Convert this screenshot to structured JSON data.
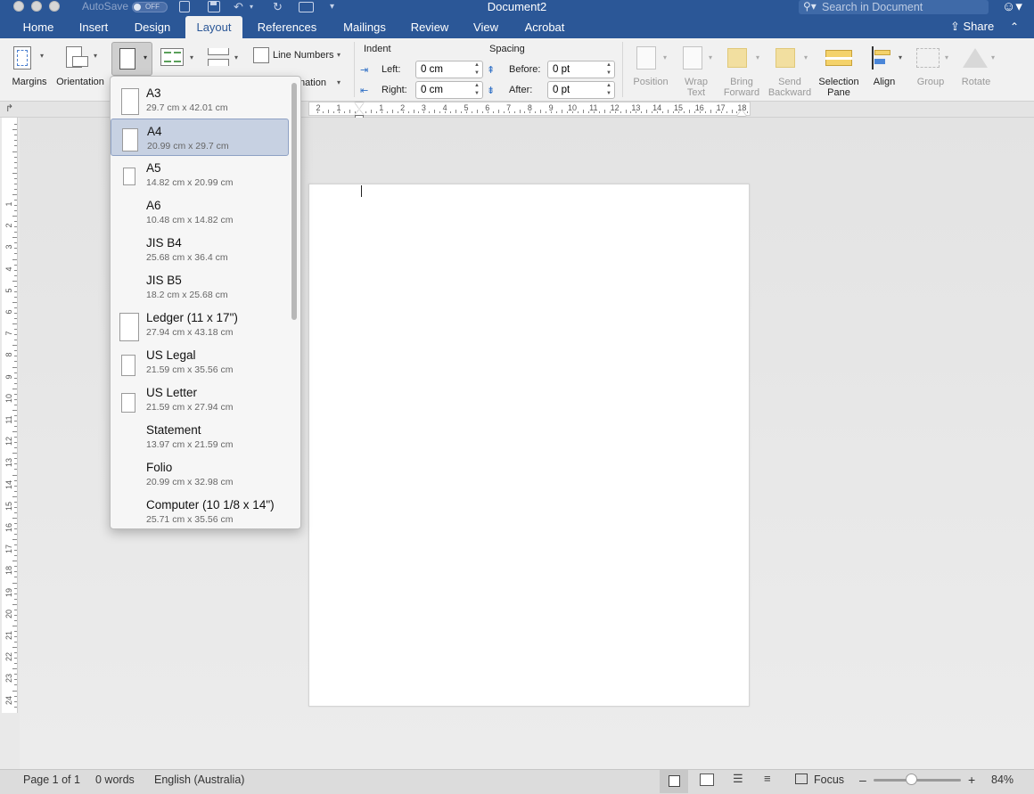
{
  "titlebar": {
    "autosave_label": "AutoSave",
    "autosave_state": "OFF",
    "document_title": "Document2",
    "search_placeholder": "Search in Document"
  },
  "tabs": [
    "Home",
    "Insert",
    "Design",
    "Layout",
    "References",
    "Mailings",
    "Review",
    "View",
    "Acrobat"
  ],
  "active_tab": "Layout",
  "share_label": "Share",
  "ribbon": {
    "margins_label": "Margins",
    "orientation_label": "Orientation",
    "line_numbers_label": "Line Numbers",
    "hyphenation_partial": "nation",
    "indent_label": "Indent",
    "indent_left_label": "Left:",
    "indent_left_value": "0 cm",
    "indent_right_label": "Right:",
    "indent_right_value": "0 cm",
    "spacing_label": "Spacing",
    "spacing_before_label": "Before:",
    "spacing_before_value": "0 pt",
    "spacing_after_label": "After:",
    "spacing_after_value": "0 pt",
    "arrange": {
      "position": "Position",
      "wrap_text_1": "Wrap",
      "wrap_text_2": "Text",
      "bring_forward_1": "Bring",
      "bring_forward_2": "Forward",
      "send_backward_1": "Send",
      "send_backward_2": "Backward",
      "selection_pane_1": "Selection",
      "selection_pane_2": "Pane",
      "align": "Align",
      "group": "Group",
      "rotate": "Rotate"
    }
  },
  "page_sizes": [
    {
      "name": "A3",
      "dims": "29.7 cm x 42.01 cm"
    },
    {
      "name": "A4",
      "dims": "20.99 cm x 29.7 cm"
    },
    {
      "name": "A5",
      "dims": "14.82 cm x 20.99 cm"
    },
    {
      "name": "A6",
      "dims": "10.48 cm x 14.82 cm"
    },
    {
      "name": "JIS B4",
      "dims": "25.68 cm x 36.4 cm"
    },
    {
      "name": "JIS B5",
      "dims": "18.2 cm x 25.68 cm"
    },
    {
      "name": "Ledger (11 x 17\")",
      "dims": "27.94 cm x 43.18 cm"
    },
    {
      "name": "US Legal",
      "dims": "21.59 cm x 35.56 cm"
    },
    {
      "name": "US Letter",
      "dims": "21.59 cm x 27.94 cm"
    },
    {
      "name": "Statement",
      "dims": "13.97 cm x 21.59 cm"
    },
    {
      "name": "Folio",
      "dims": "20.99 cm x 32.98 cm"
    },
    {
      "name": "Computer (10 1/8 x 14\")",
      "dims": "25.71 cm x 35.56 cm"
    }
  ],
  "selected_page_size": "A4",
  "horizontal_ruler_labels": [
    "2",
    "1",
    "1",
    "2",
    "3",
    "4",
    "5",
    "6",
    "7",
    "8",
    "9",
    "10",
    "11",
    "12",
    "13",
    "14",
    "15",
    "16",
    "17",
    "18"
  ],
  "vertical_ruler_labels": [
    "1",
    "2",
    "3",
    "4",
    "5",
    "6",
    "7",
    "8",
    "9",
    "10",
    "11",
    "12",
    "13",
    "14",
    "15",
    "16",
    "17",
    "18",
    "19",
    "20",
    "21",
    "22",
    "23",
    "24"
  ],
  "status": {
    "page": "Page 1 of 1",
    "words": "0 words",
    "language": "English (Australia)",
    "focus": "Focus",
    "zoom": "84%",
    "zoom_minus": "–",
    "zoom_plus": "+"
  },
  "colors": {
    "titlebar_blue": "#2b5797",
    "ribbon_bg": "#f1f1f1",
    "selected_item_bg": "#c7d1e2"
  }
}
